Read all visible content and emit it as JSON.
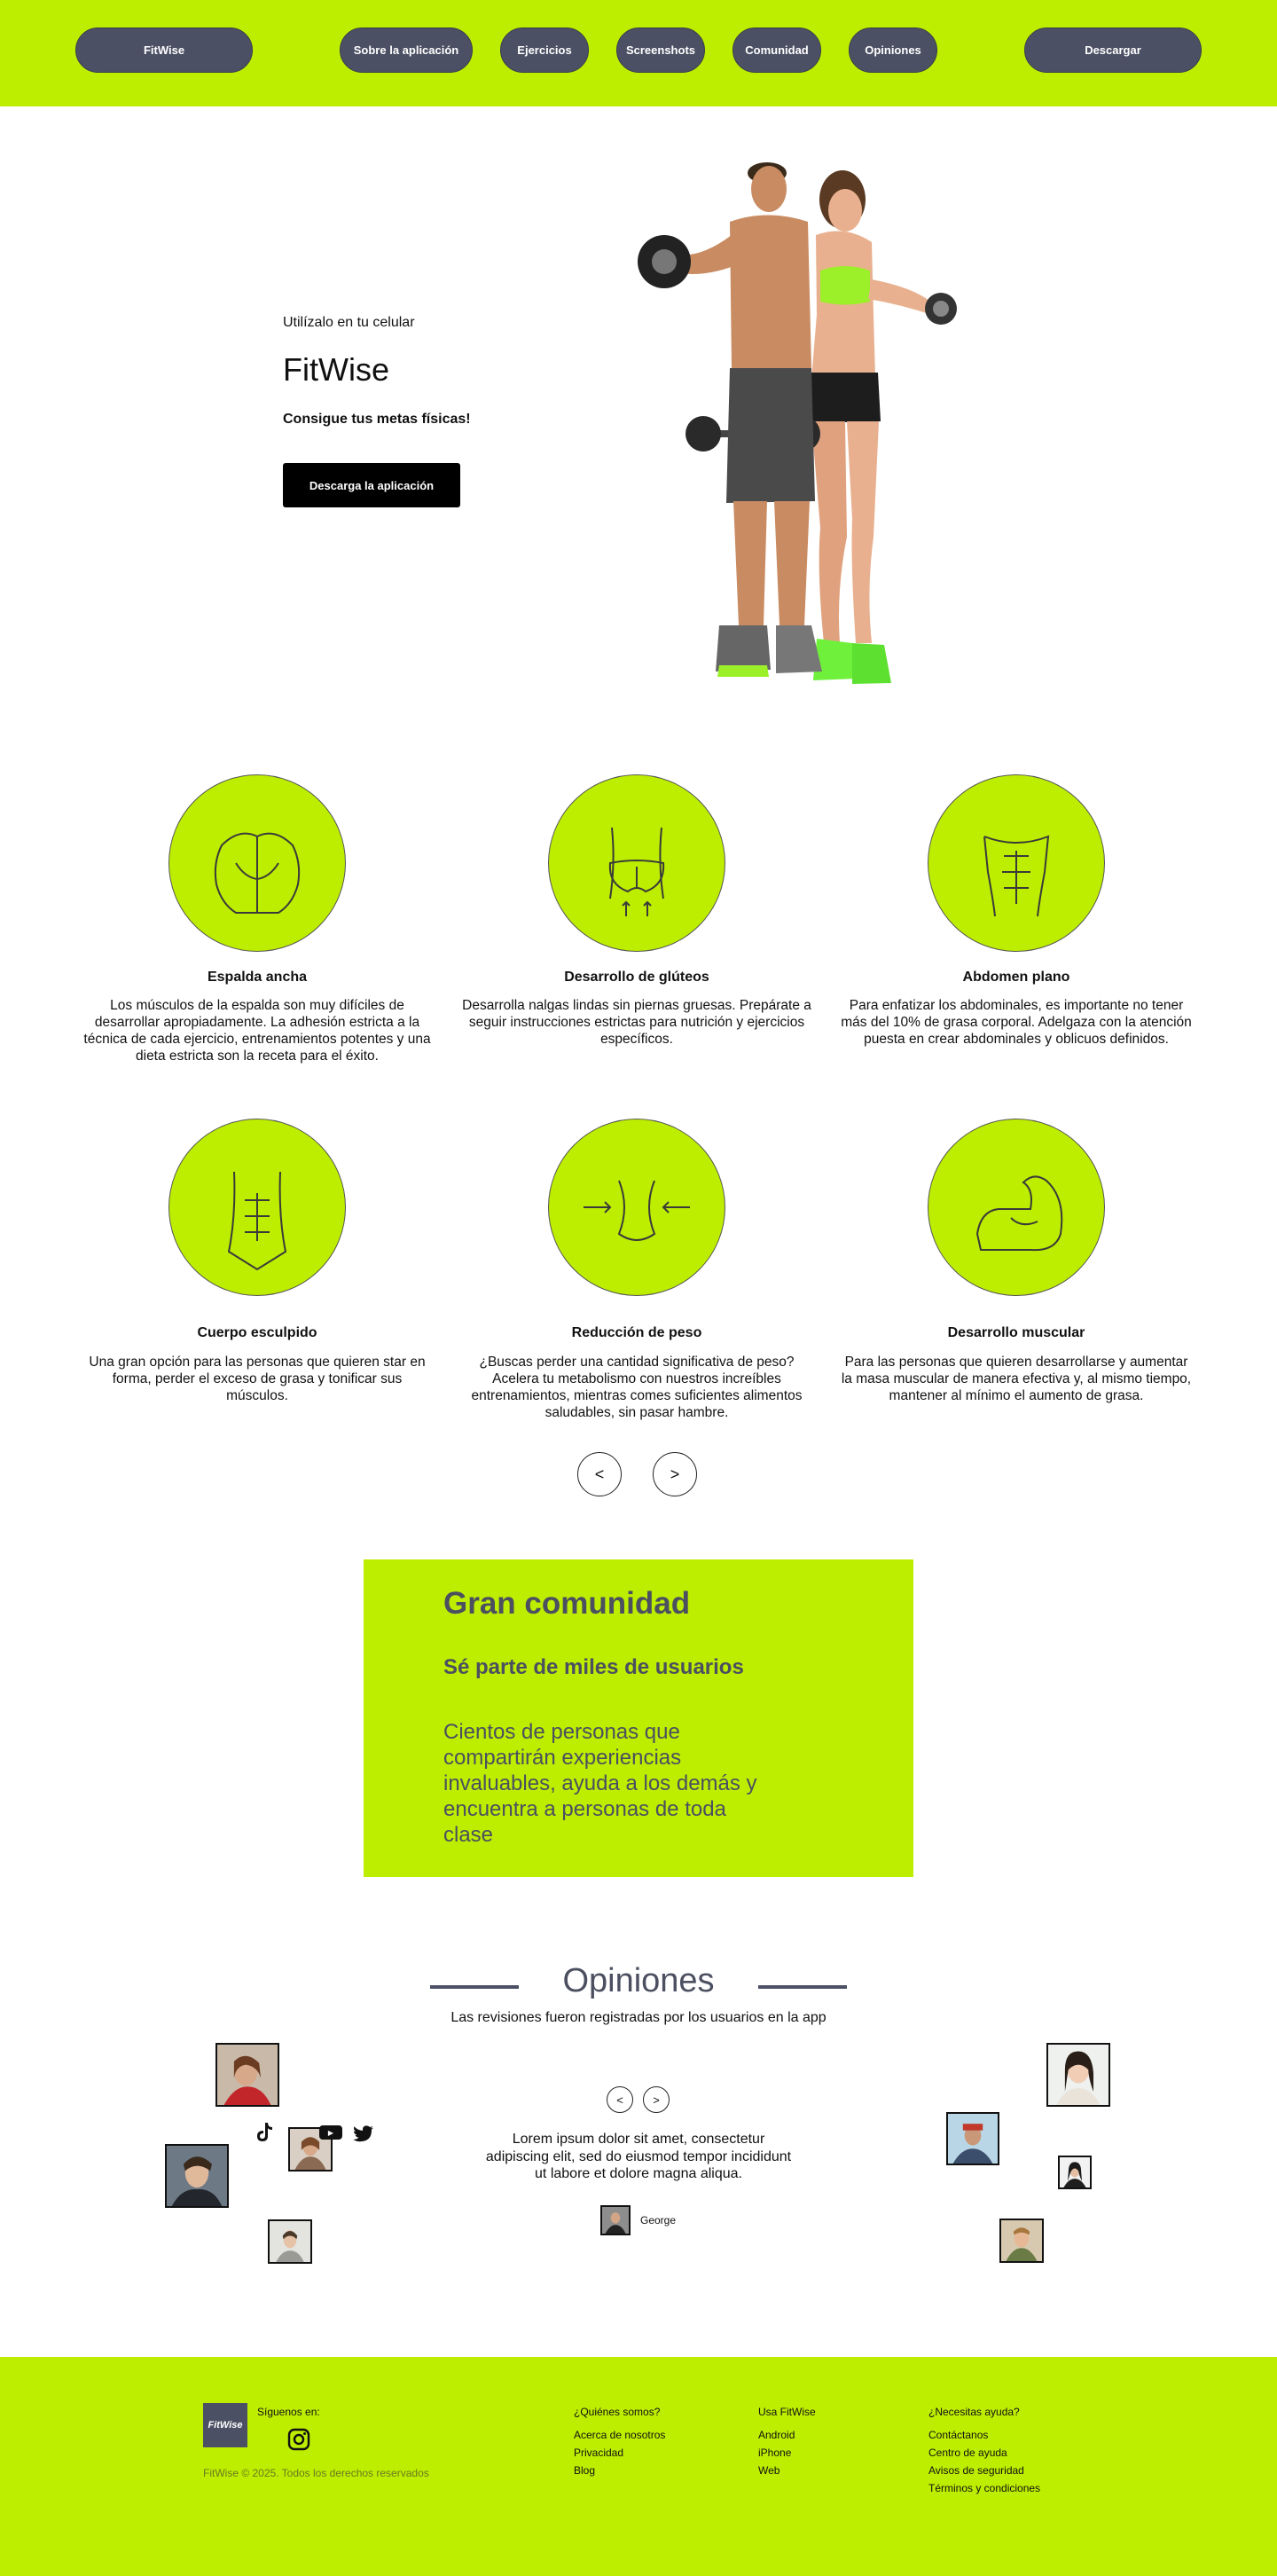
{
  "nav": {
    "brand": "FitWise",
    "links": [
      "Sobre la aplicación",
      "Ejercicios",
      "Screenshots",
      "Comunidad",
      "Opiniones"
    ],
    "download": "Descargar"
  },
  "hero": {
    "subtitle": "Utilízalo en tu celular",
    "title": "FitWise",
    "tagline": "Consigue tus metas físicas!",
    "button": "Descarga la aplicación"
  },
  "features": [
    {
      "icon": "back-muscles-icon",
      "title": "Espalda ancha",
      "desc": "Los músculos de la espalda son muy difíciles de desarrollar apropiadamente. La adhesión estricta a la técnica de cada ejercicio, entrenamientos potentes y una dieta estricta son la receta para el éxito."
    },
    {
      "icon": "glutes-icon",
      "title": "Desarrollo de glúteos",
      "desc": "Desarrolla nalgas lindas sin piernas gruesas. Prepárate a seguir instrucciones estrictas para nutrición y ejercicios específicos."
    },
    {
      "icon": "abs-icon",
      "title": "Abdomen plano",
      "desc": "Para enfatizar los abdominales, es importante no tener más del 10% de grasa corporal. Adelgaza con la atención puesta en crear abdominales y oblicuos definidos."
    },
    {
      "icon": "sculpted-body-icon",
      "title": "Cuerpo esculpido",
      "desc": "Una gran opción para las personas que quieren star en forma, perder el exceso de grasa y tonificar sus músculos."
    },
    {
      "icon": "waist-reduction-icon",
      "title": "Reducción de peso",
      "desc": "¿Buscas perder una cantidad significativa de peso? Acelera tu metabolismo con nuestros increíbles entrenamientos, mientras comes suficientes alimentos saludables, sin pasar hambre."
    },
    {
      "icon": "biceps-icon",
      "title": "Desarrollo muscular",
      "desc": "Para las personas que quieren desarrollarse y aumentar la masa muscular de manera efectiva y, al mismo tiempo, mantener al mínimo el aumento de grasa."
    }
  ],
  "carousel": {
    "prev": "<",
    "next": ">"
  },
  "community": {
    "title": "Gran comunidad",
    "subtitle": "Sé parte de miles de usuarios",
    "text": "Cientos de personas que compartirán experiencias invaluables, ayuda a los demás y encuentra a personas de toda clase"
  },
  "opinions": {
    "title": "Opiniones",
    "subtitle": "Las revisiones fueron registradas por los usuarios en la app",
    "prev": "<",
    "next": ">",
    "quote": "Lorem ipsum dolor sit amet, consectetur adipiscing elit, sed do eiusmod tempor incididunt ut labore et dolore magna aliqua.",
    "author": "George",
    "youtube_badge": "▶"
  },
  "footer": {
    "logo_text": "FitWise",
    "follow": "Síguenos en:",
    "copyright": "FitWise © 2025. Todos los derechos reservados",
    "columns": [
      {
        "title": "¿Quiénes somos?",
        "links": [
          "Acerca de nosotros",
          "Privacidad",
          "Blog"
        ]
      },
      {
        "title": "Usa FitWise",
        "links": [
          "Android",
          "iPhone",
          "Web"
        ]
      },
      {
        "title": "¿Necesitas ayuda?",
        "links": [
          "Contáctanos",
          "Centro de ayuda",
          "Avisos de seguridad",
          "Términos y condiciones"
        ]
      }
    ]
  },
  "colors": {
    "accent": "#bdee00",
    "dark": "#4c5064",
    "black": "#000000"
  }
}
